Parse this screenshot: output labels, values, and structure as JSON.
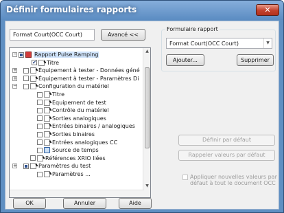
{
  "window": {
    "title": "Définir formulaires rapports",
    "close_symbol": "✕"
  },
  "left": {
    "format_value": "Format Court(OCC Court)",
    "advanced_label": "Avancé <<"
  },
  "group": {
    "label": "Formulaire rapport",
    "select_value": "Format Court(OCC Court)",
    "add_label": "Ajouter...",
    "delete_label": "Supprimer"
  },
  "tree": {
    "items": [
      {
        "label": "Rapport Pulse Ramping",
        "exp": "−",
        "check": "filled",
        "icon": "rep",
        "highlight": true
      },
      {
        "label": "Titre",
        "exp": "",
        "check": "checked",
        "icon": "doc"
      },
      {
        "label": "Équipement à tester - Données géné",
        "exp": "+",
        "check": "empty",
        "icon": "doc"
      },
      {
        "label": "Équipement à tester - Paramètres Di",
        "exp": "+",
        "check": "empty",
        "icon": "doc"
      },
      {
        "label": "Configuration du matériel",
        "exp": "−",
        "check": "empty",
        "icon": "doc"
      },
      {
        "label": "Titre",
        "exp": "",
        "check": "empty",
        "icon": "doc"
      },
      {
        "label": "Equipement de test",
        "exp": "",
        "check": "empty",
        "icon": "doc"
      },
      {
        "label": "Contrôle du matériel",
        "exp": "",
        "check": "empty",
        "icon": "doc"
      },
      {
        "label": "Sorties analogiques",
        "exp": "",
        "check": "empty",
        "icon": "doc"
      },
      {
        "label": "Entrées binaires / analogiques",
        "exp": "",
        "check": "empty",
        "icon": "doc"
      },
      {
        "label": "Sorties binaires",
        "exp": "",
        "check": "empty",
        "icon": "doc"
      },
      {
        "label": "Entrées analogiques CC",
        "exp": "",
        "check": "empty",
        "icon": "doc"
      },
      {
        "label": "Source de temps",
        "exp": "",
        "check": "empty",
        "icon": "clock"
      },
      {
        "label": "Références XRIO liées",
        "exp": "",
        "check": "empty",
        "icon": "doc"
      },
      {
        "label": "Paramètres du test",
        "exp": "+",
        "check": "filled",
        "icon": "doc"
      },
      {
        "label": "Paramètres ...",
        "exp": "",
        "check": "empty",
        "icon": "doc"
      }
    ]
  },
  "right": {
    "default_label": "Définir par défaut",
    "restore_label": "Rappeler valeurs par défaut",
    "apply_label": "Appliquer nouvelles valeurs par défaut à tout le document OCC"
  },
  "footer": {
    "ok_label": "OK",
    "cancel_label": "Annuler",
    "help_label": "Aide"
  }
}
